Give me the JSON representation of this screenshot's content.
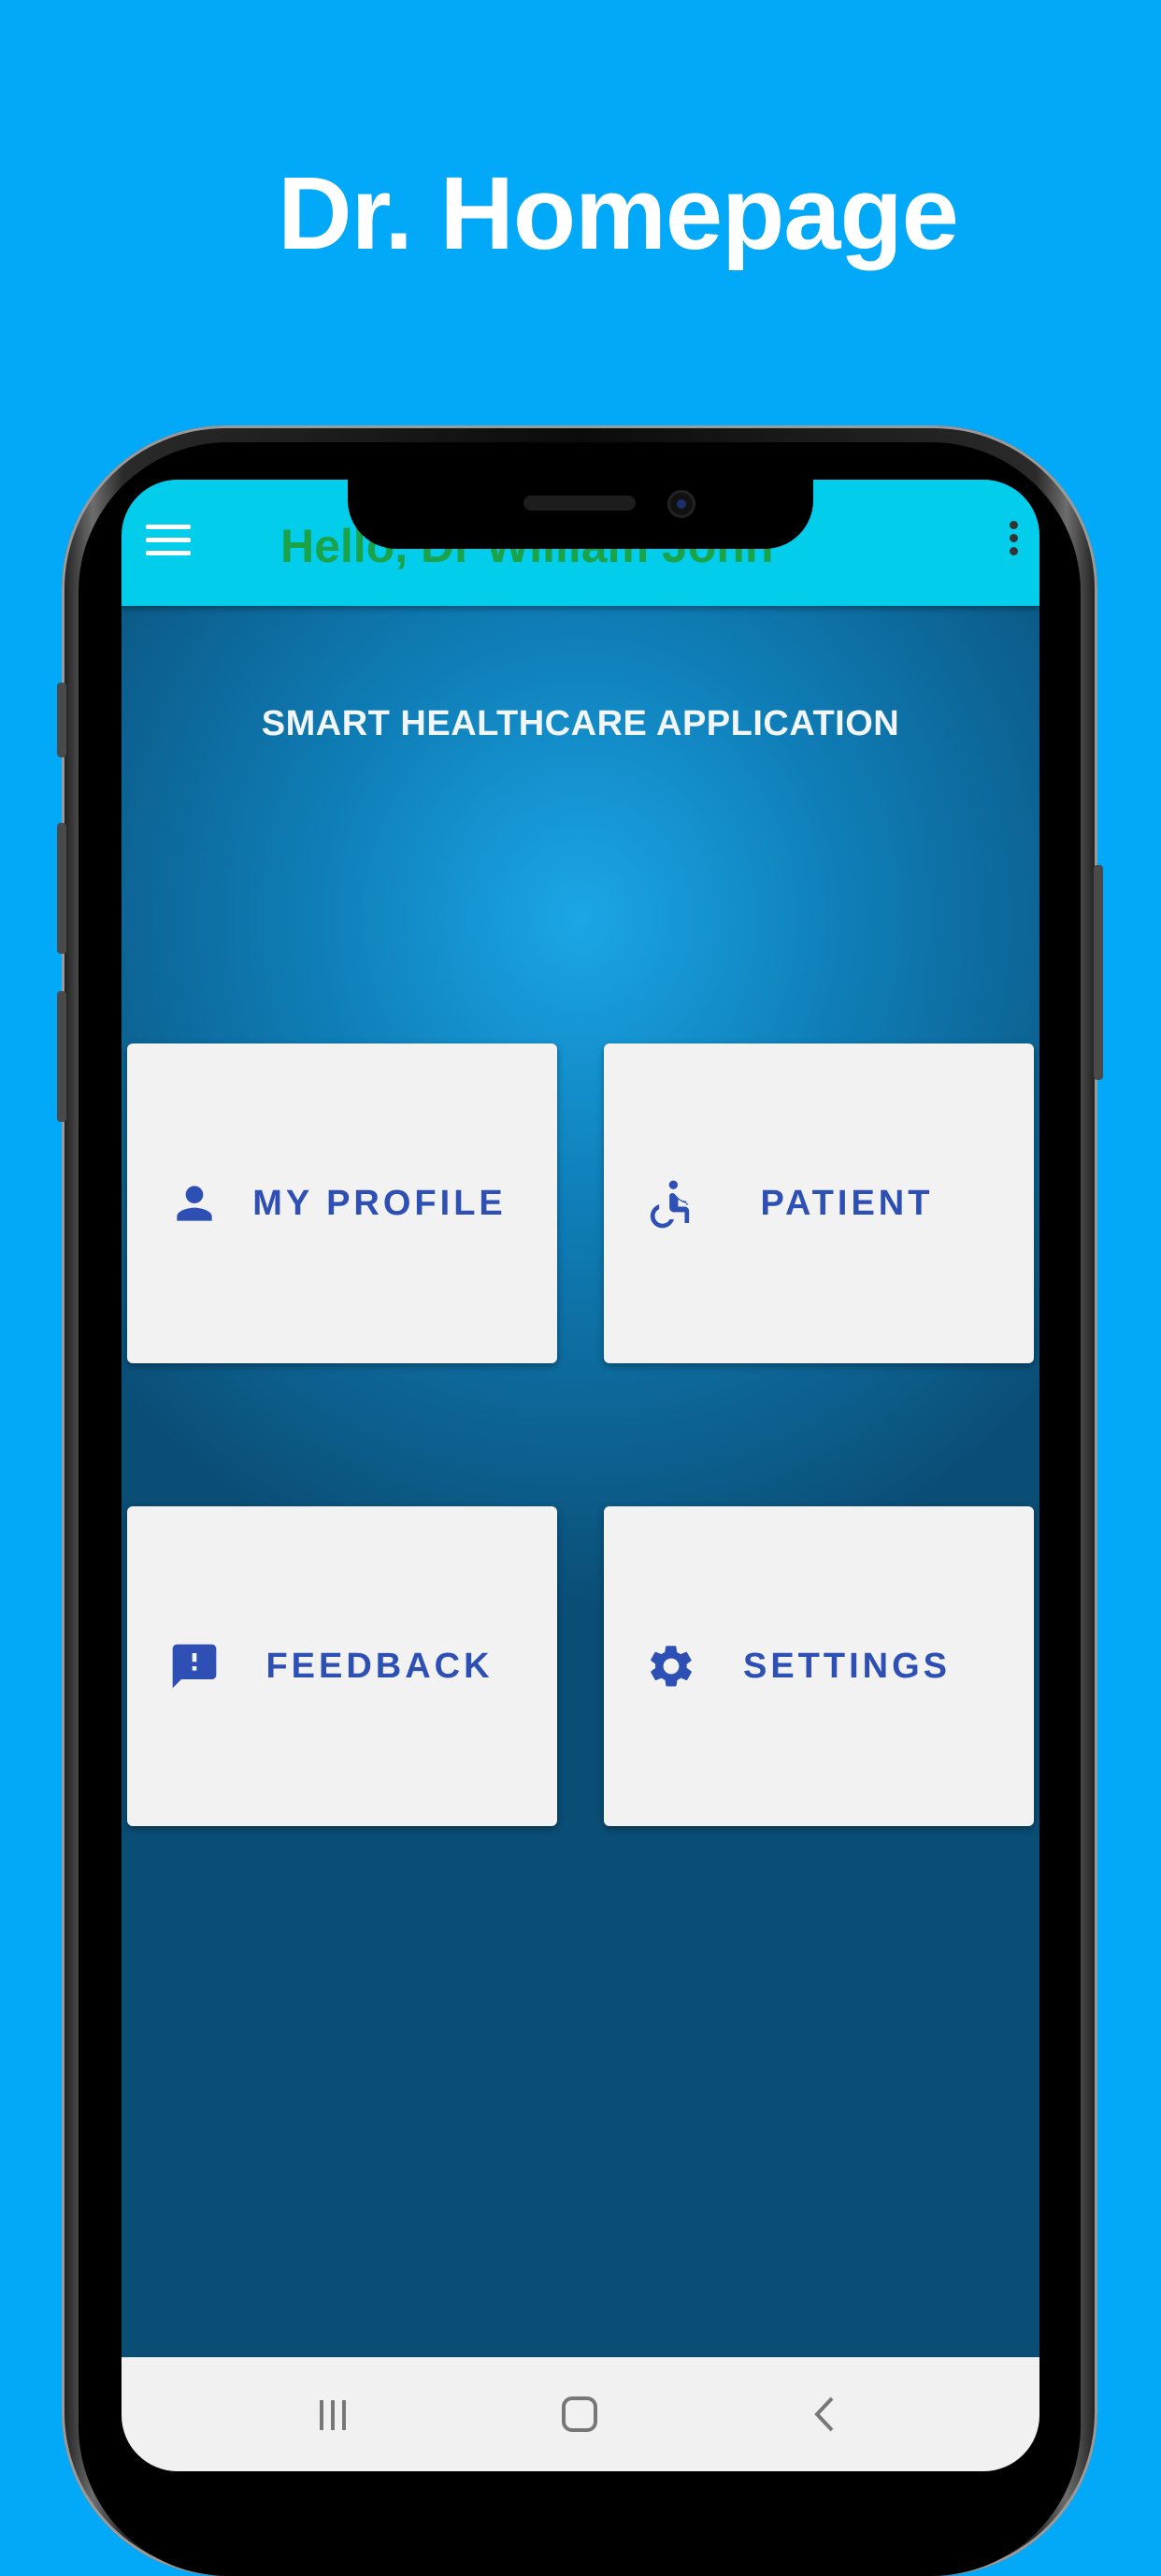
{
  "promo": {
    "title": "Dr. Homepage"
  },
  "app_bar": {
    "greeting": "Hello,  Dr William John"
  },
  "main": {
    "heading": "SMART HEALTHCARE APPLICATION"
  },
  "tiles": [
    {
      "label": "MY PROFILE",
      "icon": "person-icon"
    },
    {
      "label": "PATIENT",
      "icon": "wheelchair-icon"
    },
    {
      "label": "FEEDBACK",
      "icon": "feedback-icon"
    },
    {
      "label": "SETTINGS",
      "icon": "gear-icon"
    }
  ],
  "nav_bar": {
    "buttons": [
      "recents-icon",
      "home-icon",
      "back-icon"
    ]
  },
  "colors": {
    "background": "#03a9f9",
    "app_bar": "#02cdeb",
    "greeting": "#1ba34a",
    "tile_text": "#2e4fb4",
    "tile_background": "#f2f2f2"
  }
}
